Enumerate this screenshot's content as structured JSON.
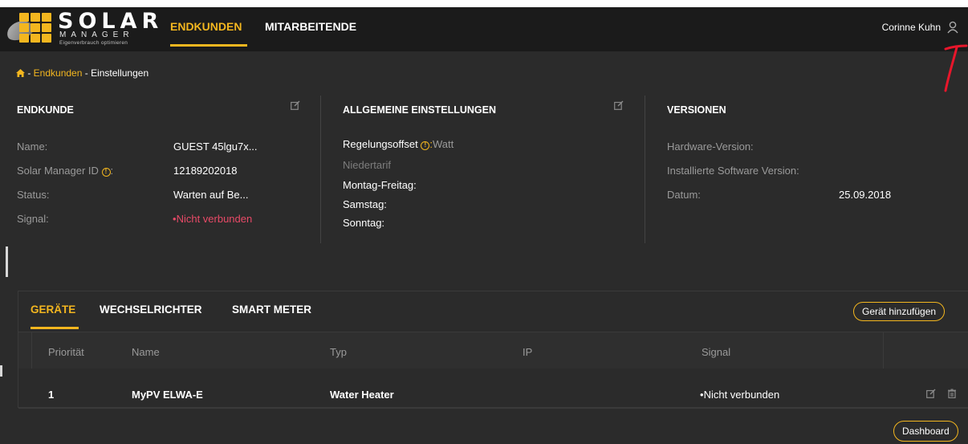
{
  "header": {
    "logo": {
      "brand": "SOLAR",
      "sub": "MANAGER",
      "tagline": "Eigenverbrauch optimieren"
    },
    "nav": [
      {
        "label": "ENDKUNDEN",
        "active": true
      },
      {
        "label": "MITARBEITENDE",
        "active": false
      }
    ],
    "user": {
      "name": "Corinne Kuhn",
      "icon": "user-icon"
    }
  },
  "breadcrumb": {
    "home_icon": "home-icon",
    "sep1": " - ",
    "link": "Endkunden",
    "sep2": " - ",
    "current": "Einstellungen"
  },
  "endkunde": {
    "title": "ENDKUNDE",
    "fields": [
      {
        "label": "Name:",
        "value": "GUEST 45lgu7x..."
      },
      {
        "label": "Solar Manager ID",
        "label_suffix": ":",
        "value": "12189202018"
      },
      {
        "label": "Status:",
        "value": "Warten auf Be..."
      },
      {
        "label": "Signal:",
        "value": "Nicht verbunden"
      }
    ]
  },
  "allgemein": {
    "title": "ALLGEMEINE EINSTELLUNGEN",
    "regelungsoffset_label": "Regelungsoffset",
    "regelungsoffset_sep": ":",
    "regelungsoffset_unit": "Watt",
    "niedertarif": "Niedertarif",
    "montag_freitag": "Montag-Freitag:",
    "samstag": "Samstag:",
    "sonntag": "Sonntag:"
  },
  "versionen": {
    "title": "VERSIONEN",
    "hardware_label": "Hardware-Version:",
    "software_label": "Installierte Software Version:",
    "datum_label": "Datum:",
    "datum_value": "25.09.2018"
  },
  "tabs": [
    {
      "label": "GERÄTE",
      "active": true
    },
    {
      "label": "WECHSELRICHTER",
      "active": false
    },
    {
      "label": "SMART METER",
      "active": false
    }
  ],
  "add_device_label": "Gerät hinzufügen",
  "table": {
    "columns": [
      "Priorität",
      "Name",
      "Typ",
      "IP",
      "Signal"
    ],
    "rows": [
      {
        "prioritaet": "1",
        "name": "MyPV ELWA-E",
        "typ": "Water Heater",
        "ip": "",
        "signal": "Nicht verbunden"
      }
    ]
  },
  "dashboard_label": "Dashboard",
  "colors": {
    "accent": "#f3b61f",
    "error": "#e84a67",
    "background": "#2b2b2b",
    "topbar": "#1b1b1b",
    "annotation": "#e8162b"
  },
  "bullet": "•"
}
